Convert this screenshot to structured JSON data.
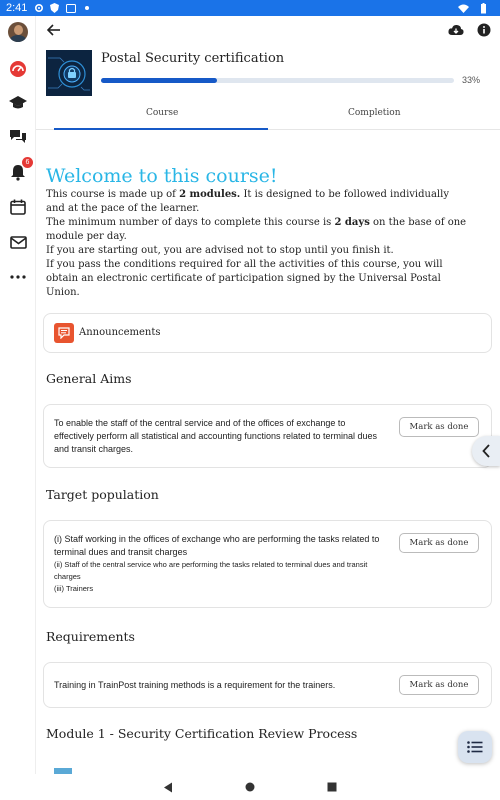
{
  "status": {
    "time": "2:41"
  },
  "header": {
    "back_icon": "arrow-left-icon",
    "download_icon": "cloud-download-icon",
    "info_icon": "info-icon"
  },
  "course": {
    "title": "Postal Security certification",
    "progress_percent": 33,
    "progress_label": "33%"
  },
  "tabs": [
    {
      "label": "Course",
      "active": true
    },
    {
      "label": "Completion",
      "active": false
    }
  ],
  "rail": {
    "items": [
      {
        "name": "avatar"
      },
      {
        "icon": "dashboard-icon"
      },
      {
        "icon": "graduation-cap-icon"
      },
      {
        "icon": "chat-icon"
      },
      {
        "icon": "bell-icon",
        "badge": "6"
      },
      {
        "icon": "calendar-icon"
      },
      {
        "icon": "mail-icon"
      },
      {
        "icon": "more-icon"
      }
    ]
  },
  "welcome": {
    "title": "Welcome to this course!",
    "p1_a": "This course is made up of ",
    "p1_bold": "2 modules.",
    "p1_b": " It is designed to be followed individually and at the pace of the learner.",
    "p2_a": "The minimum number of days to complete this course is ",
    "p2_bold": "2 days",
    "p2_b": " on the base of one module per day.",
    "p3": "If you are starting out, you are advised not to stop until you finish it.",
    "p4": "If you pass the conditions required for all the activities of this course, you will obtain an electronic certificate of participation signed by the Universal Postal Union."
  },
  "announcements": {
    "label": "Announcements"
  },
  "sections": {
    "general_aims": {
      "heading": "General Aims",
      "text": "To enable the staff of the central service and of the offices of exchange to effectively perform all statistical and accounting functions related to terminal dues and transit charges.",
      "button": "Mark as done"
    },
    "target_population": {
      "heading": "Target population",
      "line1": "(i) Staff working in the offices of exchange who are performing the tasks related to terminal dues and transit charges",
      "line2": "(ii) Staff of the central service who are performing the tasks related to terminal dues and transit charges",
      "line3": "(iii) Trainers",
      "button": "Mark as done"
    },
    "requirements": {
      "heading": "Requirements",
      "text": "Training in TrainPost training methods is a requirement for the trainers.",
      "button": "Mark as done"
    }
  },
  "module": {
    "heading": "Module 1 - Security Certification Review Process"
  },
  "colors": {
    "status_bar": "#1a73e8",
    "progress": "#1659c7",
    "welcome_title": "#29b6e6",
    "rail_dashboard": "#e53935",
    "announcement_icon": "#e8542f"
  }
}
